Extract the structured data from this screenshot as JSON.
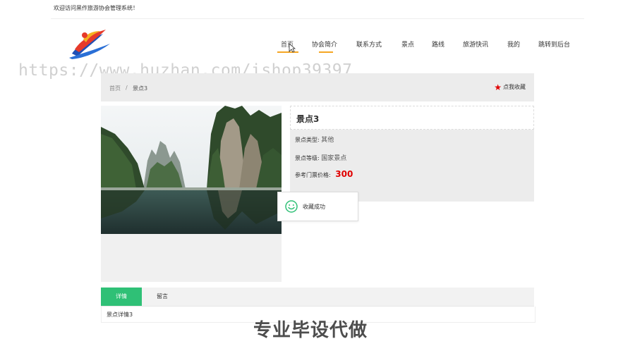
{
  "header": {
    "welcome_text": "欢迎访问黑作旅游协会管理系统！"
  },
  "nav": {
    "items": [
      {
        "label": "首页",
        "active": true
      },
      {
        "label": "协会简介",
        "active": false
      },
      {
        "label": "联系方式",
        "active": false
      },
      {
        "label": "景点",
        "active": false
      },
      {
        "label": "路线",
        "active": false
      },
      {
        "label": "旅游快讯",
        "active": false
      },
      {
        "label": "我的",
        "active": false
      },
      {
        "label": "跳转到后台",
        "active": false
      }
    ],
    "accent_color": "#f5a623"
  },
  "watermark": {
    "url_text": "https://www.huzhan.com/ishop39397",
    "bottom_text": "专业毕设代做"
  },
  "breadcrumb": {
    "home": "首页",
    "separator": "/",
    "current": "景点3"
  },
  "favorite": {
    "icon": "star-icon",
    "label": "点我收藏",
    "color": "#e00000"
  },
  "spot": {
    "title": "景点3",
    "type_label": "景点类型:",
    "type_value": "其他",
    "level_label": "景点等级:",
    "level_value": "国家景点",
    "price_label": "参考门票价格:",
    "price_value": "300"
  },
  "toast": {
    "icon": "smile-icon",
    "message": "收藏成功"
  },
  "tabs": {
    "items": [
      {
        "label": "详情",
        "active": true
      },
      {
        "label": "留言",
        "active": false
      }
    ],
    "active_color": "#2fc076",
    "content": "景点详情3"
  }
}
